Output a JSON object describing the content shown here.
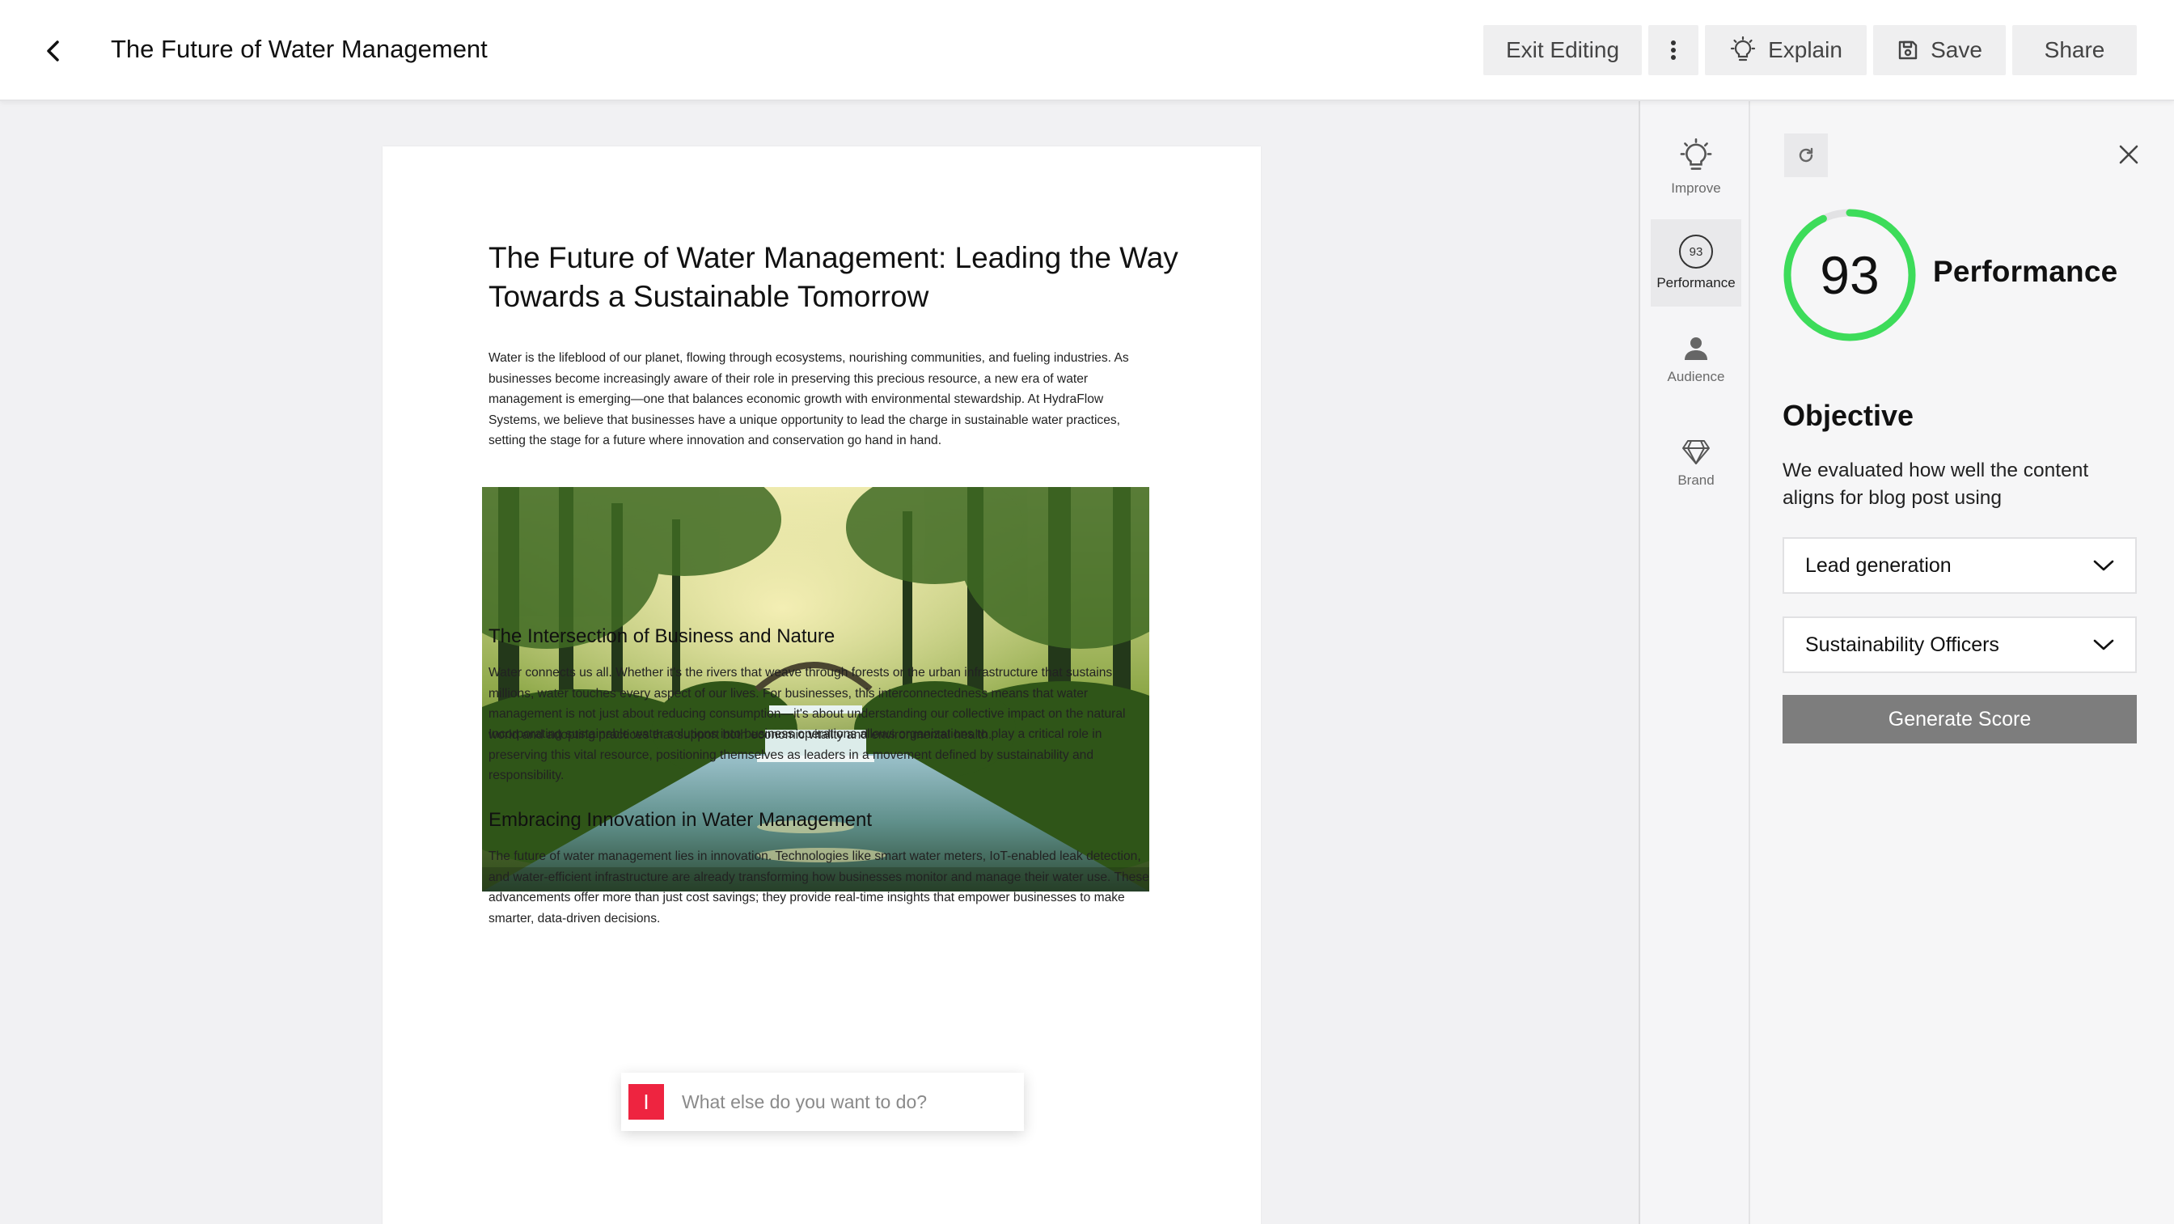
{
  "header": {
    "title": "The Future of Water Management",
    "exit_editing_label": "Exit Editing",
    "explain_label": "Explain",
    "save_label": "Save",
    "share_label": "Share"
  },
  "document": {
    "heading": "The Future of Water Management: Leading the Way Towards a Sustainable Tomorrow",
    "intro": "Water is the lifeblood of our planet, flowing through ecosystems, nourishing communities, and fueling industries. As businesses become increasingly aware of their role in preserving this precious resource, a new era of water management is emerging—one that balances economic growth with environmental stewardship. At HydraFlow Systems, we believe that businesses have a unique opportunity to lead the charge in sustainable water practices, setting the stage for a future where innovation and conservation go hand in hand.",
    "section1_heading": "The Intersection of Business and Nature",
    "section1_p1": "Water connects us all. Whether it's the rivers that weave through forests or the urban infrastructure that sustains millions, water touches every aspect of our lives. For businesses, this interconnectedness means that water management is not just about reducing consumption—it's about understanding our collective impact on the natural world and adopting practices that support both economic vitality and environmental health.",
    "section1_p2": "Incorporating sustainable water solutions into business operations allows organizations to play a critical role in preserving this vital resource, positioning themselves as leaders in a movement defined by sustainability and responsibility.",
    "section2_heading": "Embracing Innovation in Water Management",
    "section2_p1": "The future of water management lies in innovation. Technologies like smart water meters, IoT-enabled leak detection, and water-efficient infrastructure are already transforming how businesses monitor and manage their water use. These advancements offer more than just cost savings; they provide real-time insights that empower businesses to make smarter, data-driven decisions."
  },
  "prompt": {
    "badge": "I",
    "placeholder": "What else do you want to do?"
  },
  "rail": {
    "improve_label": "Improve",
    "performance_score": "93",
    "performance_label": "Performance",
    "audience_label": "Audience",
    "brand_label": "Brand"
  },
  "panel": {
    "score": "93",
    "score_fraction": 0.93,
    "score_color": "#3ddc5a",
    "title": "Performance",
    "objective_title": "Objective",
    "objective_desc": "We evaluated how well the content aligns for blog post using",
    "goal_select": "Lead generation",
    "audience_select": "Sustainability Officers",
    "generate_label": "Generate Score"
  },
  "icons": [
    "chevron-left-icon",
    "more-vertical-icon",
    "lightbulb-icon",
    "save-icon",
    "refresh-icon",
    "close-icon",
    "user-icon",
    "diamond-icon",
    "chevron-down-icon"
  ]
}
